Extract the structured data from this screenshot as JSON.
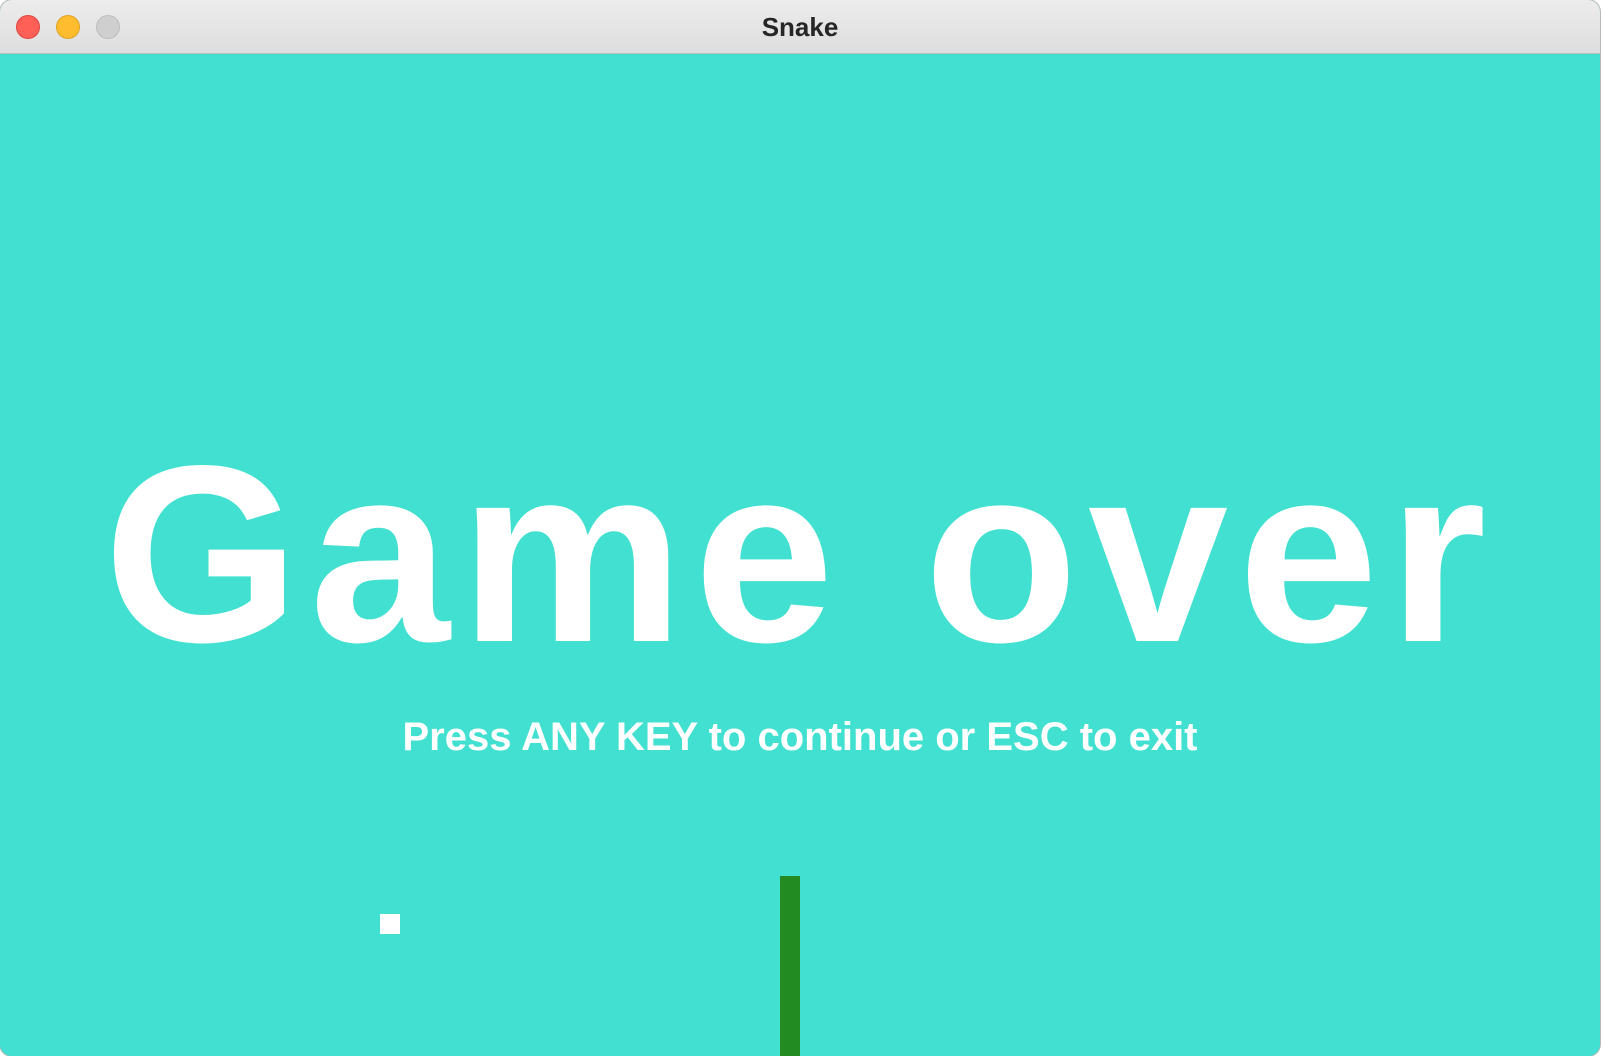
{
  "window": {
    "title": "Snake"
  },
  "game": {
    "headline": "Game over",
    "prompt": "Press ANY KEY to continue or ESC to exit",
    "colors": {
      "background": "#41e0d0",
      "text": "#ffffff",
      "snake": "#228b22",
      "food": "#ffffff"
    }
  }
}
